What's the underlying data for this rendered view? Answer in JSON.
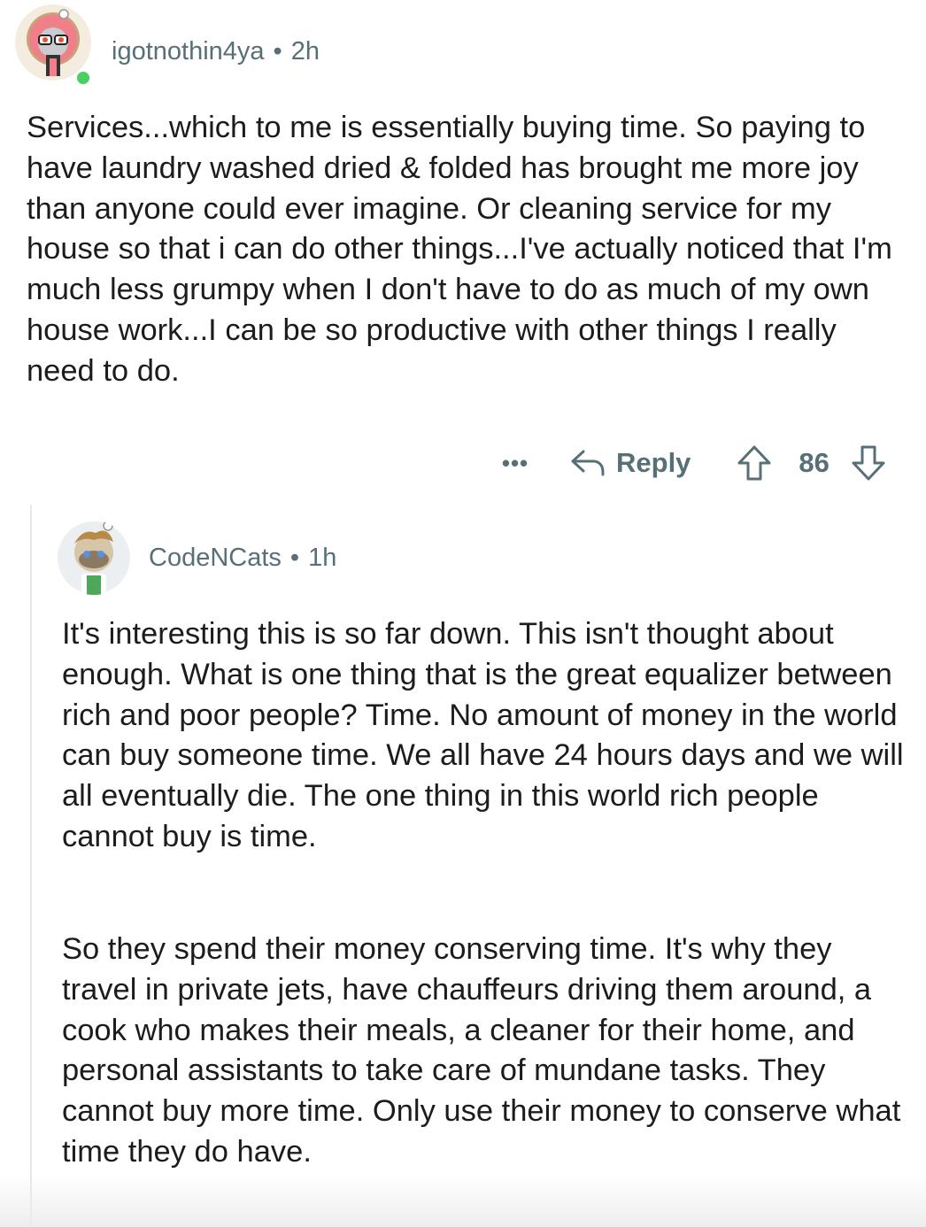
{
  "comment": {
    "username": "igotnothin4ya",
    "age": "2h",
    "separator": "•",
    "body": "Services...which to me is essentially buying time. So paying to have laundry washed dried & folded has brought me more joy than anyone could ever imagine. Or cleaning service for my house so that i can do other things...I've actually noticed that I'm much less grumpy when I don't have to do as much of my own house work...I can be so productive with other things I really need to do.",
    "more_label": "•••",
    "reply_label": "Reply",
    "score": "86",
    "online_status_color": "#46d160",
    "avatar_icon": "snoo-avatar-pink-hood-icon"
  },
  "reply": {
    "username": "CodeNCats",
    "age": "1h",
    "separator": "•",
    "paragraphs": [
      "It's interesting this is so far down. This isn't thought about enough. What is one thing that is the great equalizer between rich and poor people? Time. No amount of money in the world can buy someone time. We all have 24 hours days and we will all eventually die. The one thing in this world rich people cannot buy is time.",
      "So they spend their money conserving time. It's why they travel in private jets, have chauffeurs driving them around, a cook who makes their meals, a cleaner for their home, and personal assistants to take care of mundane tasks. They cannot buy more time. Only use their money to conserve what time they do have."
    ],
    "avatar_icon": "snoo-avatar-green-apron-icon"
  },
  "colors": {
    "meta_text": "#576f76",
    "body_text": "#1c1c1c",
    "thread_line": "#e5e9eb"
  }
}
